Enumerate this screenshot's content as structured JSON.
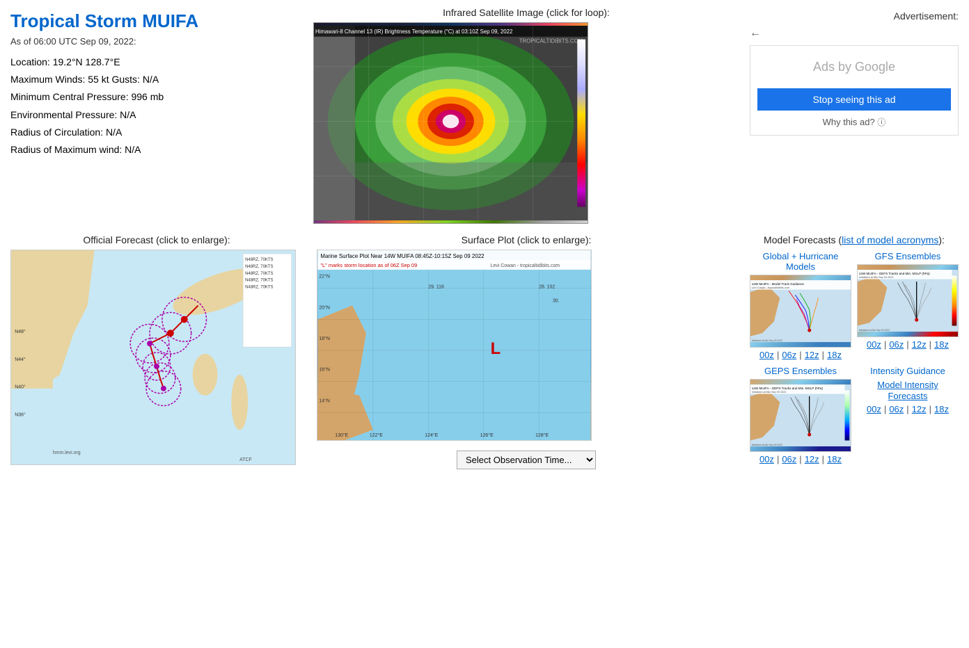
{
  "page": {
    "title": "Tropical Storm MUIFA",
    "timestamp": "As of 06:00 UTC Sep 09, 2022:",
    "storm_info": {
      "location": "Location: 19.2°N 128.7°E",
      "max_winds": "Maximum Winds: 55 kt  Gusts: N/A",
      "min_pressure": "Minimum Central Pressure: 996 mb",
      "env_pressure": "Environmental Pressure: N/A",
      "radius_circulation": "Radius of Circulation: N/A",
      "radius_max_wind": "Radius of Maximum wind: N/A"
    }
  },
  "satellite": {
    "title": "Infrared Satellite Image (click for loop):",
    "header": "Himawari-8 Channel 13 (IR) Brightness Temperature (°C) at 03:10Z Sep 09, 2022",
    "watermark": "TROPICALTIDIBITS.COM"
  },
  "advertisement": {
    "title": "Advertisement:",
    "ads_by_google": "Ads by Google",
    "stop_seeing": "Stop seeing this ad",
    "why_this_ad": "Why this ad?"
  },
  "official_forecast": {
    "title": "Official Forecast (click to enlarge):"
  },
  "surface_plot": {
    "title": "Surface Plot (click to enlarge):",
    "header": "Marine Surface Plot Near 14W MUIFA 08:45Z-10:15Z Sep 09 2022",
    "mark": "\"L\" marks storm location as of 06Z Sep 09",
    "credit": "Levi Cowan - tropicaltidibits.com",
    "storm_label": "L",
    "select_placeholder": "Select Observation Time..."
  },
  "model_forecasts": {
    "title": "Model Forecasts (",
    "link_text": "list of model acronyms",
    "title_end": "):",
    "global_hurricane": {
      "title": "Global + Hurricane Models",
      "header": "14W MUIFA - Model Track Guidance",
      "subheader": "Levi Cowan - tropicaltidibits.com",
      "init": "Initialized at 06z Sep 09 2022",
      "links": [
        "00z",
        "06z",
        "12z",
        "18z"
      ]
    },
    "gfs_ensembles": {
      "title": "GFS Ensembles",
      "header": "14W MUIFA - GEFS Tracks and Min. MSLP (hPa)",
      "init": "Initialized at 06z Sep 09 2022",
      "links": [
        "00z",
        "06z",
        "12z",
        "18z"
      ]
    },
    "geps_ensembles": {
      "title": "GEPS Ensembles",
      "header": "14W MUIFA - GEPS Tracks and Min. MSLP (hPa)",
      "init": "Initialized at 06z Sep 09 2022",
      "links": [
        "00z",
        "06z",
        "12z",
        "18z"
      ]
    },
    "intensity_guidance": {
      "title": "Intensity Guidance",
      "link_text": "Model Intensity Forecasts",
      "links": [
        "00z",
        "06z",
        "12z",
        "18z"
      ]
    }
  }
}
